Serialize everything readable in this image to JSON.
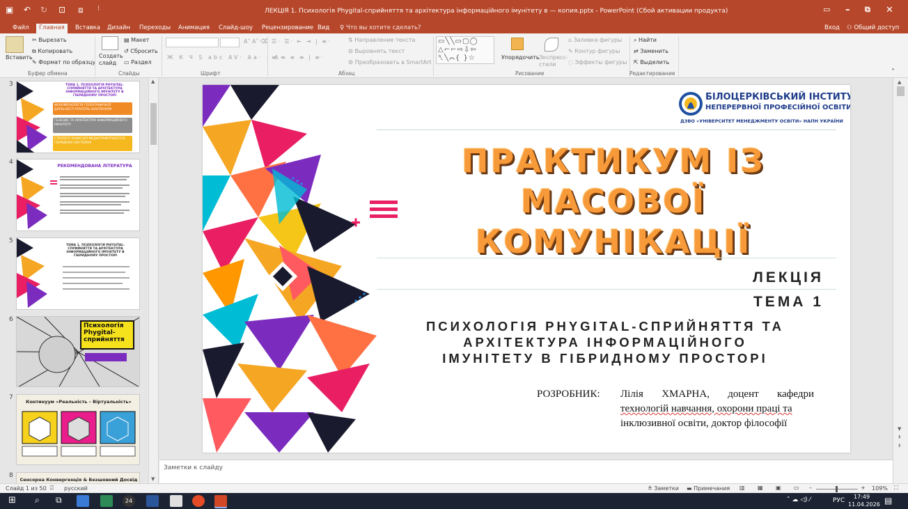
{
  "app": {
    "window_title": "ЛЕКЦІЯ 1. Психологія Phygital-сприйняття та архітектура інформаційного імунітету в — копия.pptx - PowerPoint (Сбой активации продукта)",
    "signin": "Вход",
    "share": "Общий доступ",
    "colors": {
      "accent": "#b7472a",
      "slide_orange": "#f79a3a"
    }
  },
  "tabs": [
    "Файл",
    "Главная",
    "Вставка",
    "Дизайн",
    "Переходы",
    "Анимация",
    "Слайд-шоу",
    "Рецензирование",
    "Вид"
  ],
  "tell_me": "Что вы хотите сделать?",
  "ribbon": {
    "clipboard": {
      "paste": "Вставить",
      "cut": "Вырезать",
      "copy": "Копировать",
      "format_painter": "Формат по образцу",
      "group": "Буфер обмена"
    },
    "slides": {
      "new_slide": "Создать слайд",
      "layout": "Макет",
      "reset": "Сбросить",
      "section": "Раздел",
      "group": "Слайды"
    },
    "font": {
      "group": "Шрифт"
    },
    "paragraph": {
      "text_direction": "Направление текста",
      "align_text": "Выровнять текст",
      "smartart": "Преобразовать в SmartArt",
      "group": "Абзац"
    },
    "drawing": {
      "arrange": "Упорядочить",
      "quick_styles": "Экспресс-стили",
      "fill": "Заливка фигуры",
      "outline": "Контур фигуры",
      "effects": "Эффекты фигуры",
      "group": "Рисование"
    },
    "editing": {
      "find": "Найти",
      "replace": "Заменить",
      "select": "Выделить",
      "group": "Редактирование"
    }
  },
  "thumbnails": [
    {
      "num": "3",
      "title": "ТЕМА 1. ПСИХОЛОГІЯ PHYGITAL-СПРИЙНЯТТЯ ТА АРХІТЕКТУРА ІНФОРМАЦІЙНОГО ІМУНІТЕТУ В ГІБРИДНОМУ ПРОСТОРІ",
      "items": [
        "ФЕНОМЕНОЛОГІЯ ГОЛОГРАФІЧНОЇ ДІЯЛЬНОСТІ PHYGITAL-КОНТИНУУМ",
        "ГЕНЕЗИС ТА АРХІТЕКТУРА ІНФОРМАЦІЙНОГО ІМУНІТЕТУ",
        "СТРАТЕГІЇ ЗАХИСНОЇ МЕДІАГРАМОТНОСТІ В ГІБРИДНИХ СИСТЕМАХ"
      ]
    },
    {
      "num": "4",
      "title": "РЕКОМЕНДОВАНА ЛІТЕРАТУРА"
    },
    {
      "num": "5",
      "title": "ТЕМА 1. ПСИХОЛОГІЯ PHYGITAL-СПРИЙНЯТТЯ ТА АРХІТЕКТУРА ІНФОРМАЦІЙНОГО ІМУНІТЕТУ В ГІБРИДНОМУ ПРОСТОРІ"
    },
    {
      "num": "6",
      "title": "Психологія Phygital-сприйняття"
    },
    {
      "num": "7",
      "title": "Континуум «Реальність – Віртуальність»"
    },
    {
      "num": "8",
      "title": "Сенсорна Конвергенція & Безшовний Досвід"
    }
  ],
  "slide": {
    "institute_name": "БІЛОЦЕРКІВСЬКИЙ ІНСТИТУТ",
    "institute_sub": "НЕПЕРЕРВНОЇ ПРОФЕСІЙНОЇ ОСВІТИ",
    "institute_parent": "ДЗВО «УНІВЕРСИТЕТ МЕНЕДЖМЕНТУ ОСВІТИ» НАПН УКРАЇНИ",
    "title_lines": [
      "ПРАКТИКУМ ІЗ",
      "МАСОВОЇ",
      "КОМУНІКАЦІЇ"
    ],
    "lecture": "ЛЕКЦІЯ",
    "topic": "ТЕМА 1",
    "subtitle_lines": [
      "ПСИХОЛОГІЯ PHYGITAL-СПРИЙНЯТТЯ ТА",
      "АРХІТЕКТУРА ІНФОРМАЦІЙНОГО",
      "ІМУНІТЕТУ В ГІБРИДНОМУ ПРОСТОРІ"
    ],
    "developer_label": "РОЗРОБНИК:",
    "developer_lines": [
      "Лілія ХМАРНА, доцент кафедри",
      "технологій навчання, охорони праці та",
      "інклюзивної освіти, доктор філософії"
    ]
  },
  "notes_placeholder": "Заметки к слайду",
  "status": {
    "slide_counter": "Слайд 1 из 50",
    "language": "русский",
    "notes": "Заметки",
    "comments": "Примечания",
    "zoom": "109%"
  },
  "taskbar": {
    "lang": "РУС",
    "time": "17:49",
    "date": "11.04.2026",
    "badge": "24"
  }
}
